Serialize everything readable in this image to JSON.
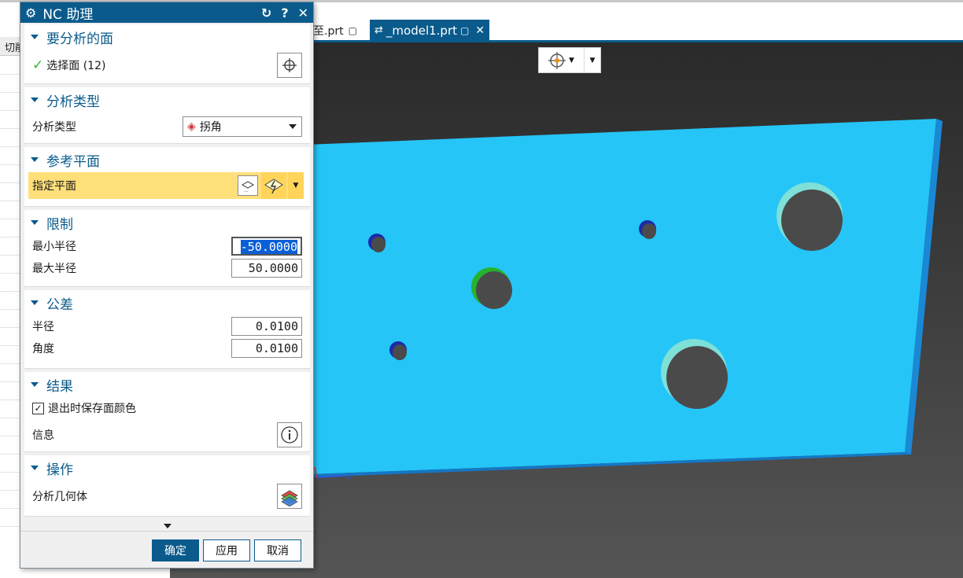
{
  "dialog": {
    "title": "NC 助理",
    "sections": {
      "faces": {
        "title": "要分析的面",
        "select_label": "选择面 (12)"
      },
      "analysis_type": {
        "title": "分析类型",
        "label": "分析类型",
        "value": "拐角"
      },
      "ref_plane": {
        "title": "参考平面",
        "label": "指定平面"
      },
      "limits": {
        "title": "限制",
        "min_label": "最小半径",
        "min_value": "-50.0000",
        "max_label": "最大半径",
        "max_value": "50.0000"
      },
      "tolerance": {
        "title": "公差",
        "radius_label": "半径",
        "radius_value": "0.0100",
        "angle_label": "角度",
        "angle_value": "0.0100"
      },
      "results": {
        "title": "结果",
        "save_color_label": "退出时保存面颜色",
        "save_color_checked": true,
        "info_label": "信息"
      },
      "operation": {
        "title": "操作",
        "analyze_label": "分析几何体"
      }
    },
    "buttons": {
      "ok": "确定",
      "apply": "应用",
      "cancel": "取消"
    }
  },
  "tabs": [
    {
      "label": "至.prt"
    },
    {
      "label": "_model1.prt"
    }
  ],
  "left_panel": {
    "header": "切削"
  },
  "colors": {
    "accent": "#0a5b8c",
    "plate": "#25c5f7",
    "highlight": "#ffdf7a"
  }
}
